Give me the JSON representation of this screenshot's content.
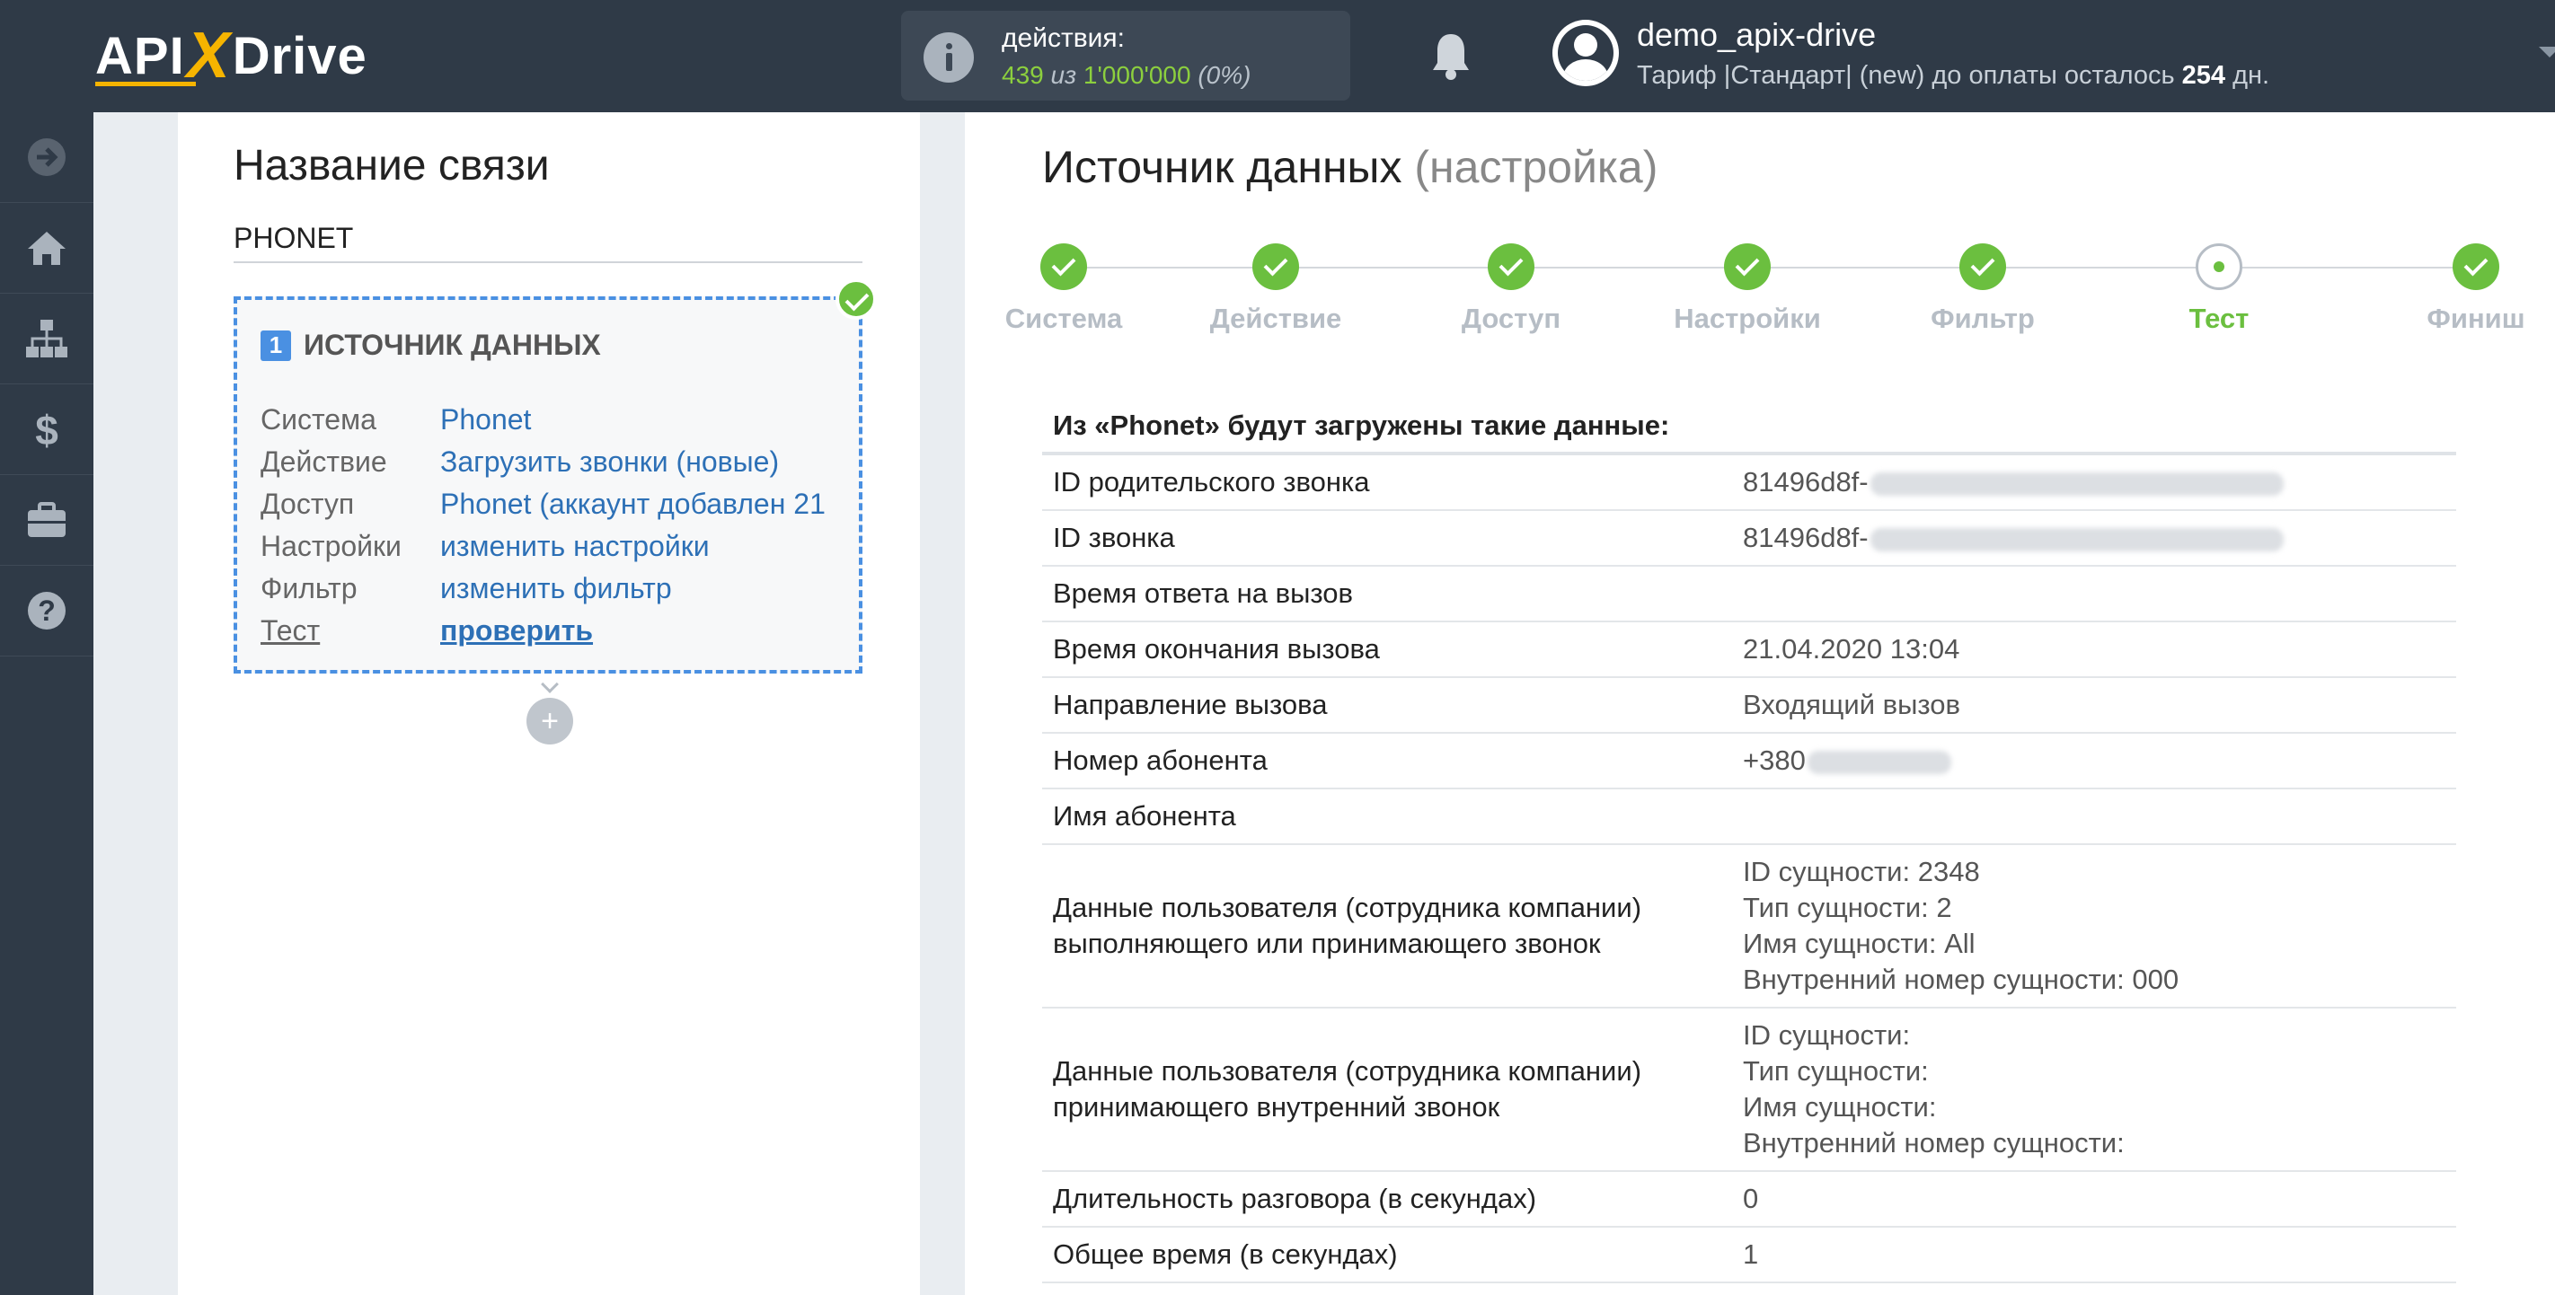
{
  "header": {
    "logo_left": "API",
    "logo_x": "X",
    "logo_right": "Drive",
    "actions_label": "действия:",
    "actions_used": "439",
    "actions_of": "из",
    "actions_total": "1'000'000",
    "actions_percent": "(0%)",
    "username": "demo_apix-drive",
    "plan_prefix": "Тариф |Стандарт| (new) до оплаты осталось",
    "plan_days": "254",
    "plan_suffix": "дн."
  },
  "sidebar": {
    "items": [
      "arrow-right-circle-icon",
      "home-icon",
      "sitemap-icon",
      "dollar-icon",
      "briefcase-icon",
      "help-icon"
    ]
  },
  "left_panel": {
    "title": "Название связи",
    "connection_name": "PHONET",
    "card": {
      "number": "1",
      "title": "ИСТОЧНИК ДАННЫХ",
      "rows": [
        {
          "key": "Система",
          "value": "Phonet"
        },
        {
          "key": "Действие",
          "value": "Загрузить звонки (новые)"
        },
        {
          "key": "Доступ",
          "value": "Phonet (аккаунт добавлен 21"
        },
        {
          "key": "Настройки",
          "value": "изменить настройки"
        },
        {
          "key": "Фильтр",
          "value": "изменить фильтр"
        },
        {
          "key": "Тест",
          "value": "проверить"
        }
      ]
    },
    "add_label": "+"
  },
  "right_panel": {
    "title": "Источник данных",
    "title_sub": "(настройка)",
    "steps": [
      {
        "label": "Система",
        "state": "done"
      },
      {
        "label": "Действие",
        "state": "done"
      },
      {
        "label": "Доступ",
        "state": "done"
      },
      {
        "label": "Настройки",
        "state": "done"
      },
      {
        "label": "Фильтр",
        "state": "done"
      },
      {
        "label": "Тест",
        "state": "current"
      },
      {
        "label": "Финиш",
        "state": "done"
      }
    ],
    "table_header": "Из «Phonet» будут загружены такие данные:",
    "rows": [
      {
        "key": "ID родительского звонка",
        "value": [
          "81496d8f-"
        ],
        "blurred": true
      },
      {
        "key": "ID звонка",
        "value": [
          "81496d8f-"
        ],
        "blurred": true
      },
      {
        "key": "Время ответа на вызов",
        "value": [
          ""
        ]
      },
      {
        "key": "Время окончания вызова",
        "value": [
          "21.04.2020 13:04"
        ]
      },
      {
        "key": "Направление вызова",
        "value": [
          "Входящий вызов"
        ]
      },
      {
        "key": "Номер абонента",
        "value": [
          "+380"
        ],
        "blurred": true
      },
      {
        "key": "Имя абонента",
        "value": [
          ""
        ]
      },
      {
        "key": "Данные пользователя (сотрудника компании) выполняющего или принимающего звонок",
        "value": [
          "ID сущности: 2348",
          "Тип сущности: 2",
          "Имя сущности: All",
          "Внутренний номер сущности: 000"
        ]
      },
      {
        "key": "Данные пользователя (сотрудника компании) принимающего внутренний звонок",
        "value": [
          "ID сущности:",
          "Тип сущности:",
          "Имя сущности:",
          "Внутренний номер сущности:"
        ]
      },
      {
        "key": "Длительность разговора (в секундах)",
        "value": [
          "0"
        ]
      },
      {
        "key": "Общее время (в секундах)",
        "value": [
          "1"
        ]
      }
    ]
  },
  "colors": {
    "topbar": "#2f3a47",
    "accent_green": "#6bbf3f",
    "link_blue": "#2d70b6",
    "logo_yellow": "#f6b400"
  }
}
